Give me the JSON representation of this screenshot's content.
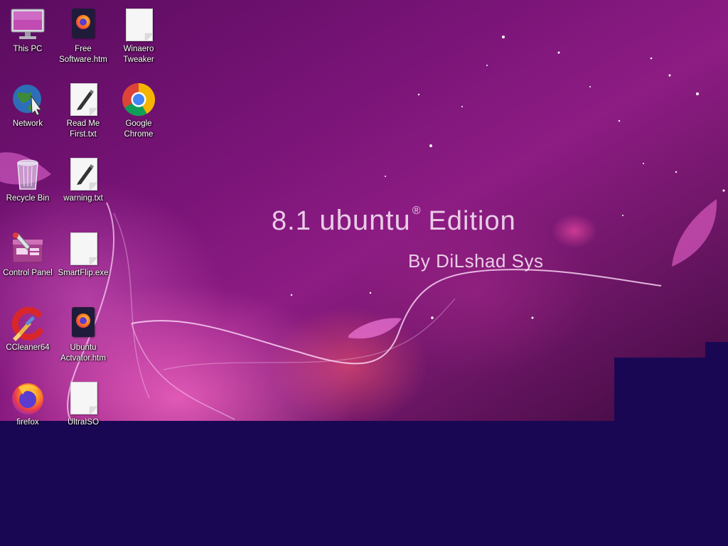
{
  "desktop": {
    "wallpaper": {
      "headline_version": "8.1",
      "headline_brand": "ubuntu",
      "headline_mark": "®",
      "headline_edition": "Edition",
      "byline": "By DiLshad Sys"
    },
    "icons": [
      {
        "label": "This PC",
        "icon": "monitor-icon"
      },
      {
        "label": "Free\nSoftware.htm",
        "icon": "firefox-html-file-icon"
      },
      {
        "label": "Winaero\nTweaker",
        "icon": "blank-file-icon"
      },
      {
        "label": "Network",
        "icon": "network-globe-icon"
      },
      {
        "label": "Read Me\nFirst.txt",
        "icon": "text-file-icon"
      },
      {
        "label": "Google\nChrome",
        "icon": "chrome-icon"
      },
      {
        "label": "Recycle Bin",
        "icon": "recycle-bin-icon"
      },
      {
        "label": "warning.txt",
        "icon": "text-file-icon"
      },
      {
        "label": "Control Panel",
        "icon": "control-panel-icon"
      },
      {
        "label": "SmartFlip.exe",
        "icon": "blank-file-icon"
      },
      {
        "label": "CCleaner64",
        "icon": "ccleaner-icon"
      },
      {
        "label": "Ubuntu\nActvator.htm",
        "icon": "firefox-html-file-icon"
      },
      {
        "label": "firefox",
        "icon": "firefox-icon"
      },
      {
        "label": "UltraISO",
        "icon": "blank-file-icon"
      }
    ]
  }
}
